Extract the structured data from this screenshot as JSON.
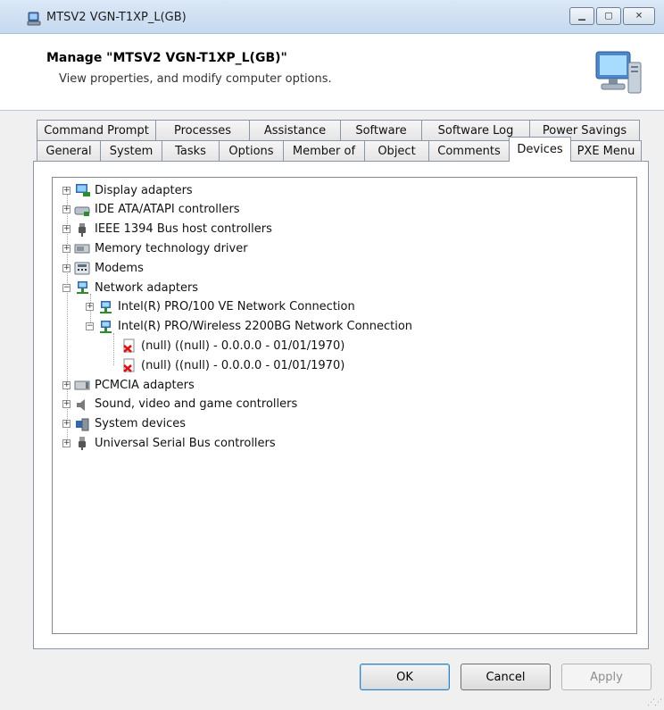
{
  "window": {
    "title": "MTSV2 VGN-T1XP_L(GB)",
    "accent": "#c5d9ef"
  },
  "header": {
    "title": "Manage \"MTSV2 VGN-T1XP_L(GB)\"",
    "subtitle": "View properties, and modify computer options."
  },
  "tabs_row1": [
    "Command Prompt",
    "Processes",
    "Assistance",
    "Software",
    "Software Log",
    "Power Savings"
  ],
  "tabs_row2": [
    "General",
    "System",
    "Tasks",
    "Options",
    "Member of",
    "Object",
    "Comments",
    "Devices",
    "PXE Menu"
  ],
  "active_tab": "Devices",
  "tree": [
    {
      "label": "Display adapters",
      "icon": "display-adapter-icon",
      "expander": "+"
    },
    {
      "label": "IDE ATA/ATAPI controllers",
      "icon": "ide-controller-icon",
      "expander": "+"
    },
    {
      "label": "IEEE 1394 Bus host controllers",
      "icon": "ieee1394-icon",
      "expander": "+"
    },
    {
      "label": "Memory technology driver",
      "icon": "memory-icon",
      "expander": "+"
    },
    {
      "label": "Modems",
      "icon": "modem-icon",
      "expander": "+"
    },
    {
      "label": "Network adapters",
      "icon": "network-adapter-icon",
      "expander": "−"
    },
    {
      "label": "Intel(R) PRO/100 VE Network Connection",
      "icon": "network-adapter-icon",
      "expander": "+"
    },
    {
      "label": "Intel(R) PRO/Wireless 2200BG Network Connection",
      "icon": "network-adapter-icon",
      "expander": "−"
    },
    {
      "label": "(null) ((null) - 0.0.0.0 - 01/01/1970)",
      "icon": "error-document-icon",
      "expander": ""
    },
    {
      "label": "(null) ((null) - 0.0.0.0 - 01/01/1970)",
      "icon": "error-document-icon",
      "expander": ""
    },
    {
      "label": "PCMCIA adapters",
      "icon": "pcmcia-icon",
      "expander": "+"
    },
    {
      "label": "Sound, video and game controllers",
      "icon": "speaker-icon",
      "expander": "+"
    },
    {
      "label": "System devices",
      "icon": "system-device-icon",
      "expander": "+"
    },
    {
      "label": "Universal Serial Bus controllers",
      "icon": "usb-icon",
      "expander": "+"
    }
  ],
  "buttons": {
    "ok": "OK",
    "cancel": "Cancel",
    "apply": "Apply"
  }
}
